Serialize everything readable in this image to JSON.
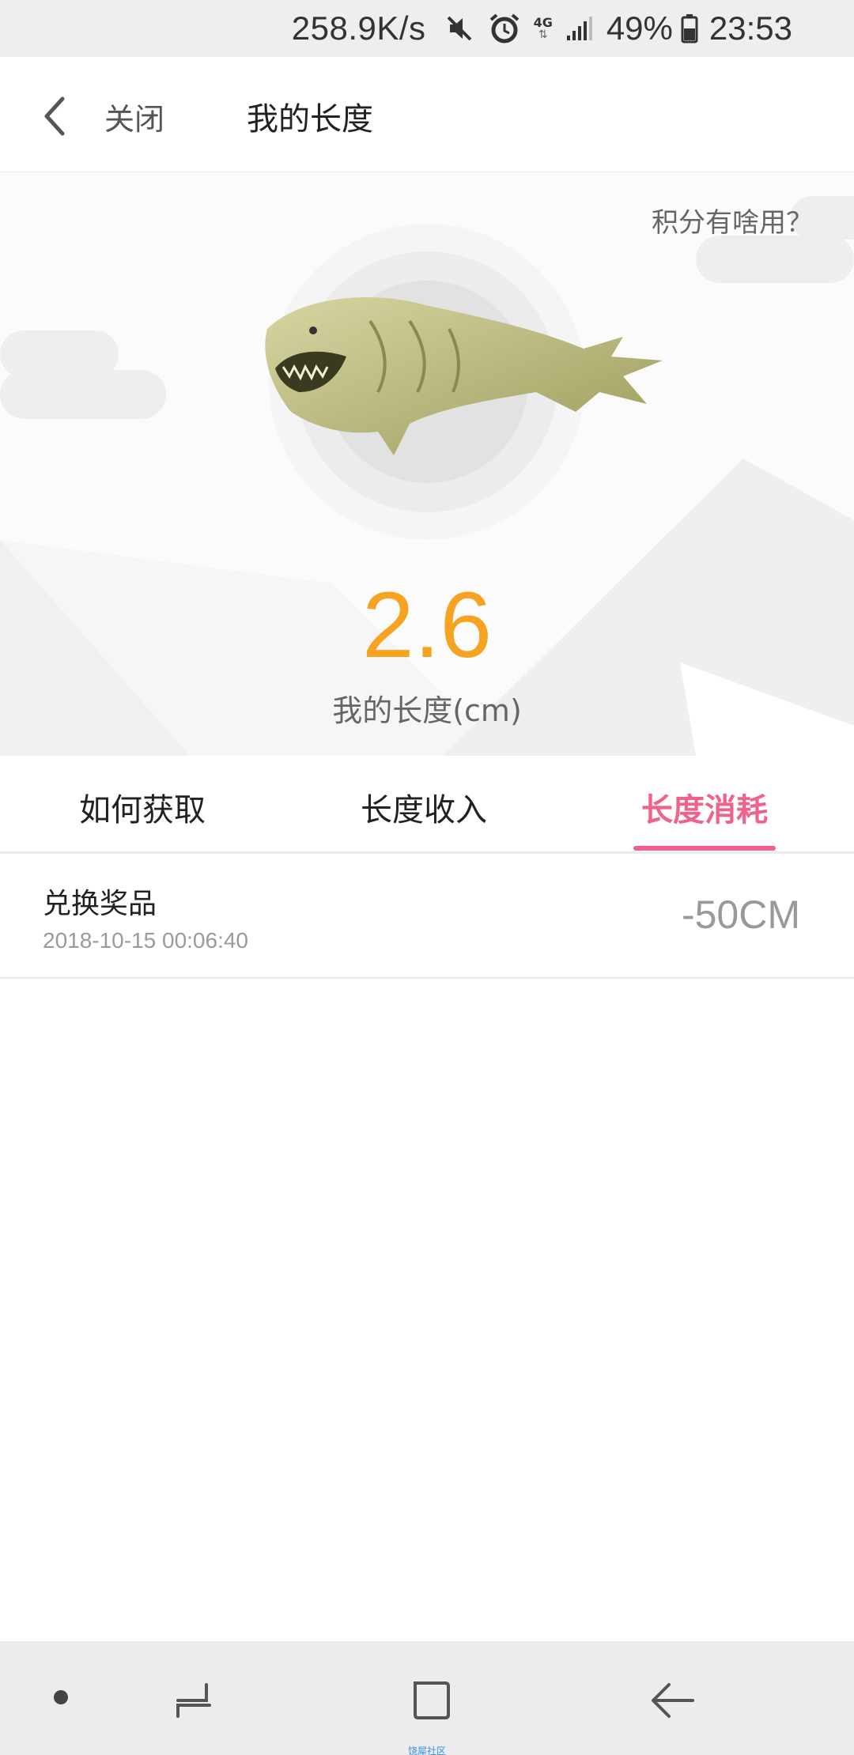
{
  "status_bar": {
    "net_speed": "258.9K/s",
    "icons": [
      "mute-icon",
      "alarm-icon",
      "4g-icon",
      "signal-icon"
    ],
    "network_label": "4G",
    "battery_percent": "49%",
    "time": "23:53"
  },
  "header": {
    "back_icon": "chevron-left-icon",
    "close_label": "关闭",
    "title": "我的长度"
  },
  "hero": {
    "help_link": "积分有啥用？",
    "creature_icon": "sea-creature-illustration",
    "value": "2.6",
    "label": "我的长度(cm)",
    "accent_color": "#f5a321"
  },
  "tabs": {
    "items": [
      {
        "label": "如何获取",
        "active": false
      },
      {
        "label": "长度收入",
        "active": false
      },
      {
        "label": "长度消耗",
        "active": true
      }
    ],
    "active_color": "#f0628c"
  },
  "records": [
    {
      "title": "兑换奖品",
      "time": "2018-10-15 00:06:40",
      "amount": "-50CM"
    }
  ],
  "nav_bar": {
    "icons": [
      "dot-icon",
      "recent-apps-icon",
      "home-icon",
      "back-icon"
    ],
    "caption": "饶犀社区"
  }
}
